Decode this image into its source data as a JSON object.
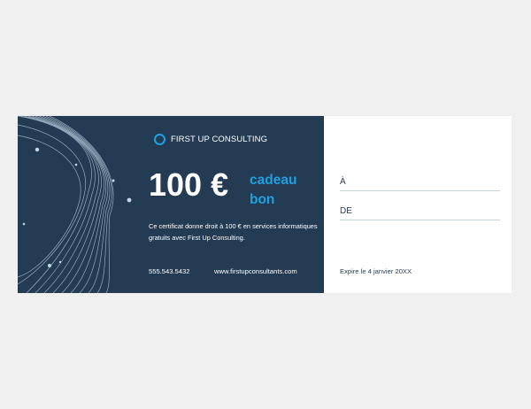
{
  "certificate": {
    "brand": "FIRST UP CONSULTING",
    "amount": "100 €",
    "gift_line1": "cadeau",
    "gift_line2": "bon",
    "description": "Ce certificat donne droit à 100 € en services informatiques gratuits avec First Up Consulting.",
    "phone": "555.543.5432",
    "website": "www.firstupconsultants.com",
    "to_label": "À",
    "from_label": "DE",
    "expiry": "Expire le 4 janvier 20XX"
  },
  "colors": {
    "panel": "#243b54",
    "accent": "#1fa0e3",
    "background": "#f0f0f0"
  },
  "icons": {
    "brand_icon": "ring-icon"
  }
}
